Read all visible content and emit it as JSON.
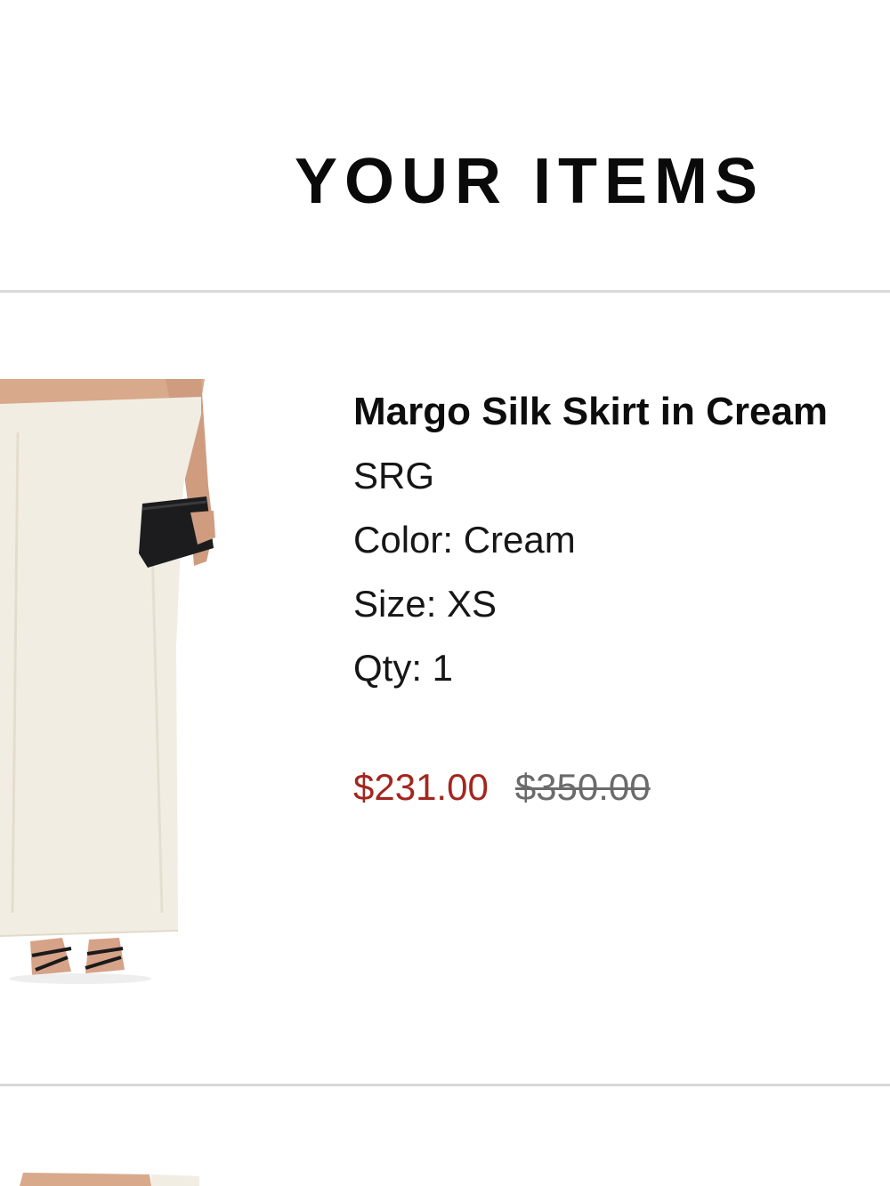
{
  "section": {
    "title": "YOUR ITEMS"
  },
  "items": [
    {
      "name": "Margo Silk Skirt in Cream",
      "brand": "SRG",
      "color_line": "Color: Cream",
      "size_line": "Size: XS",
      "qty_line": "Qty: 1",
      "sale_price": "$231.00",
      "original_price": "$350.00",
      "image_icon": "product-photo-skirt"
    }
  ],
  "colors": {
    "sale_price": "#a3261f",
    "original_price": "#6b6b6b",
    "divider": "#d9d9d9",
    "skirt": "#f1ede2"
  }
}
